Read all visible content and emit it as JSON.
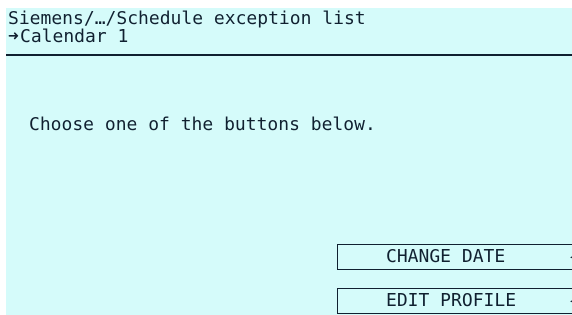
{
  "header": {
    "path": "Siemens/…/Schedule exception list",
    "item_arrow": "➜",
    "item": "Calendar 1"
  },
  "main": {
    "message": "Choose one of the buttons below."
  },
  "softkeys": [
    {
      "label": "CHANGE DATE",
      "icon": "left-arrow-icon"
    },
    {
      "label": "EDIT PROFILE",
      "icon": "left-arrow-icon"
    }
  ],
  "colors": {
    "screen_bg": "#d5fbfa",
    "text": "#102030"
  }
}
